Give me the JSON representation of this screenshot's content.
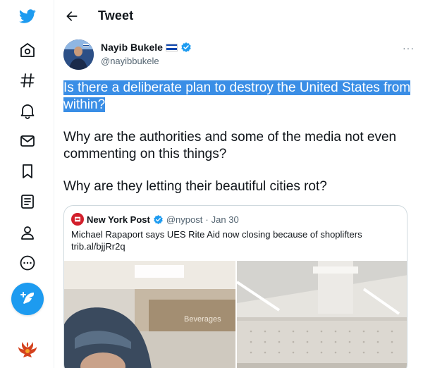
{
  "sidebar": {
    "items": [
      "twitter-logo",
      "home-icon",
      "explore-icon",
      "notifications-icon",
      "messages-icon",
      "bookmarks-icon",
      "lists-icon",
      "profile-icon",
      "more-icon"
    ],
    "compose_icon": "feather-plus-icon",
    "brand_color": "#1d9bf0"
  },
  "header": {
    "back_icon": "arrow-left-icon",
    "title": "Tweet"
  },
  "tweet": {
    "author_name": "Nayib Bukele",
    "author_handle": "@nayibbukele",
    "more_label": "···",
    "text_line1": "Is there a deliberate plan to destroy the United States from within?",
    "text_line2": "Why are the authorities and some of the media not even commenting on this things?",
    "text_line3": "Why are they letting their beautiful cities rot?",
    "highlight_color": "#3a8ee6"
  },
  "quote": {
    "author_name": "New York Post",
    "author_handle": "@nypost",
    "separator": "·",
    "date": "Jan 30",
    "text": "Michael Rapaport says UES Rite Aid now closing because of shoplifters",
    "link": "trib.al/bjjRr2q",
    "image_sign": "Beverages"
  }
}
